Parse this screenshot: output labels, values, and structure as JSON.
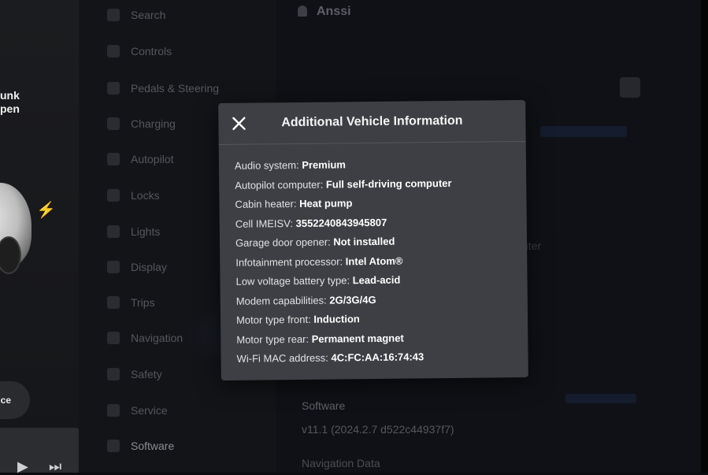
{
  "left_panel": {
    "trunk_label_line1": "unk",
    "trunk_label_line2": "pen",
    "pill_button_label": "ce",
    "media": {
      "play_icon": "play-icon",
      "next_icon": "next-track-icon"
    }
  },
  "menu": {
    "items": [
      {
        "label": "Search",
        "icon": "search-icon"
      },
      {
        "label": "Controls",
        "icon": "controls-icon"
      },
      {
        "label": "Pedals & Steering",
        "icon": "steering-icon"
      },
      {
        "label": "Charging",
        "icon": "charging-icon"
      },
      {
        "label": "Autopilot",
        "icon": "autopilot-icon"
      },
      {
        "label": "Locks",
        "icon": "lock-icon"
      },
      {
        "label": "Lights",
        "icon": "light-icon"
      },
      {
        "label": "Display",
        "icon": "display-icon"
      },
      {
        "label": "Trips",
        "icon": "trips-icon"
      },
      {
        "label": "Navigation",
        "icon": "navigation-icon"
      },
      {
        "label": "Safety",
        "icon": "safety-icon"
      },
      {
        "label": "Service",
        "icon": "service-icon"
      },
      {
        "label": "Software",
        "icon": "download-icon"
      }
    ]
  },
  "main": {
    "profile_name": "Anssi",
    "ghost_text": "uter",
    "software_label": "Software",
    "software_version": "v11.1 (2024.2.7 d522c44937f7)",
    "navigation_data_label": "Navigation Data"
  },
  "modal": {
    "title": "Additional Vehicle Information",
    "close_icon": "close-icon",
    "rows": [
      {
        "label": "Audio system:",
        "value": "Premium"
      },
      {
        "label": "Autopilot computer:",
        "value": "Full self-driving computer"
      },
      {
        "label": "Cabin heater:",
        "value": "Heat pump"
      },
      {
        "label": "Cell IMEISV:",
        "value": "3552240843945807"
      },
      {
        "label": "Garage door opener:",
        "value": "Not installed"
      },
      {
        "label": "Infotainment processor:",
        "value": "Intel Atom®"
      },
      {
        "label": "Low voltage battery type:",
        "value": "Lead-acid"
      },
      {
        "label": "Modem capabilities:",
        "value": "2G/3G/4G"
      },
      {
        "label": "Motor type front:",
        "value": "Induction"
      },
      {
        "label": "Motor type rear:",
        "value": "Permanent magnet"
      },
      {
        "label": "Wi-Fi MAC address:",
        "value": "4C:FC:AA:16:74:43"
      }
    ]
  }
}
